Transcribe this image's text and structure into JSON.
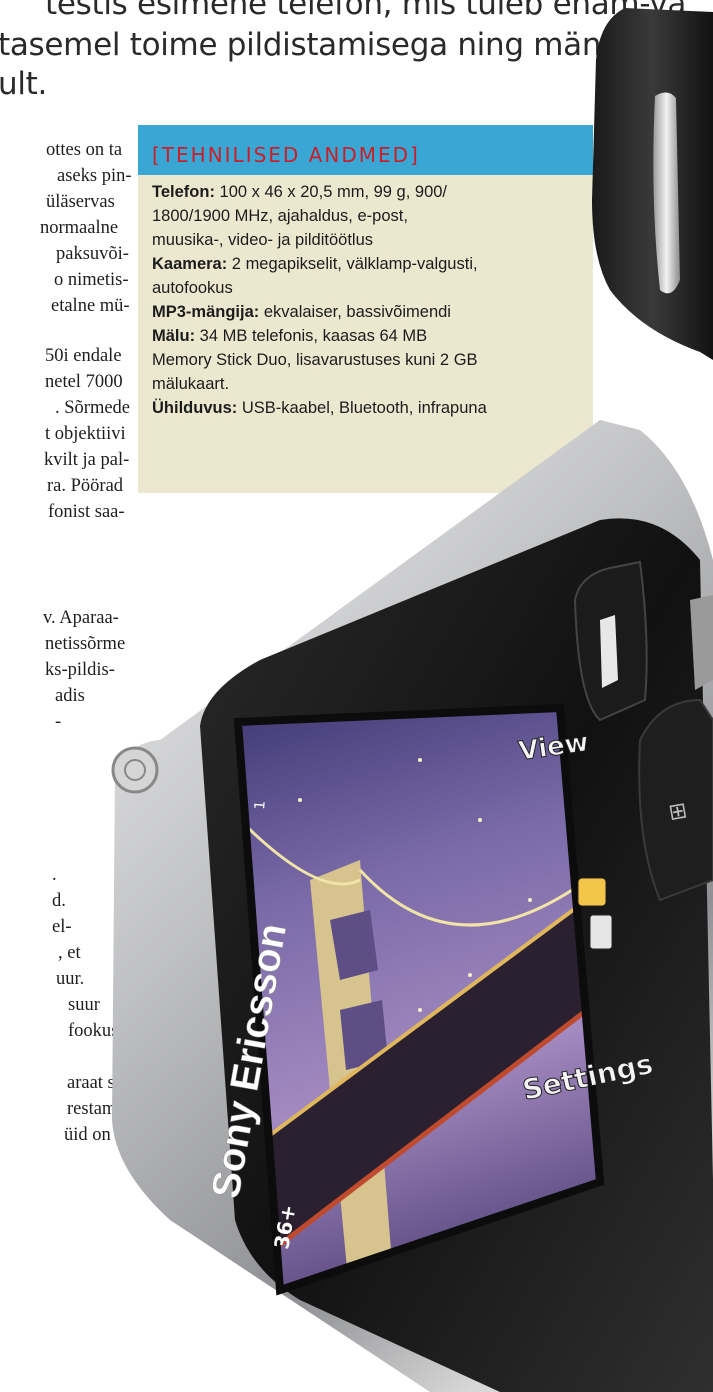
{
  "article": {
    "lede_lines": [
      "testis esimene telefon, mis tuleb enam-vä",
      "tasemel toime pildistamisega ning mängib",
      "ult."
    ],
    "body_lines": [
      "ottes on ta",
      "aseks pin-",
      "üläservas",
      "normaalne",
      "paksuvõi-",
      "o nimetis-",
      "etalne mü-",
      "50i endale",
      "netel 7000",
      ". Sõrmede",
      "t objektiivi",
      "kvilt ja pal-",
      "ra. Pöörad",
      "fonist saa-",
      "v. Aparaa-",
      "netissõrme",
      "ks-pildis-",
      "adis",
      "-",
      ".",
      "d.",
      "el-",
      ", et",
      "uur.",
      "suur",
      "fookus",
      "araat sa-",
      "restamine",
      "üid on sa-"
    ]
  },
  "specs": {
    "title": "[TEHNILISED ANDMED]",
    "l1_label": "Telefon:",
    "l1_text": " 100 x 46 x 20,5 mm, 99 g, 900/",
    "l2_text": "1800/1900 MHz, ajahaldus, e-post,",
    "l3_text": "muusika-, video- ja pilditöötlus",
    "l4_label": "Kaamera:",
    "l4_text": " 2 megapikselit, välklamp-valgusti,",
    "l5_text": "autofookus",
    "l6_label": "MP3-mängija:",
    "l6_text": " ekvalaiser, bassivõimendi",
    "l7_label": "Mälu:",
    "l7_text": " 34 MB telefonis, kaasas 64 MB",
    "l8_text": "Memory Stick Duo, lisavarustuses kuni 2 GB",
    "l9_text": "mälukaart.",
    "l10_label": "Ühilduvus:",
    "l10_text": " USB-kaabel, Bluetooth, infrapuna"
  },
  "phone": {
    "brand_text": "Sony Ericsson",
    "screen_view_label": "View",
    "screen_settings_label": "Settings",
    "screen_zoom_label": "1",
    "screen_shots_label": "36+"
  },
  "colors": {
    "specs_header": "#3aa6d3",
    "specs_title": "#c8202b",
    "specs_bg": "#ebe8cf"
  }
}
